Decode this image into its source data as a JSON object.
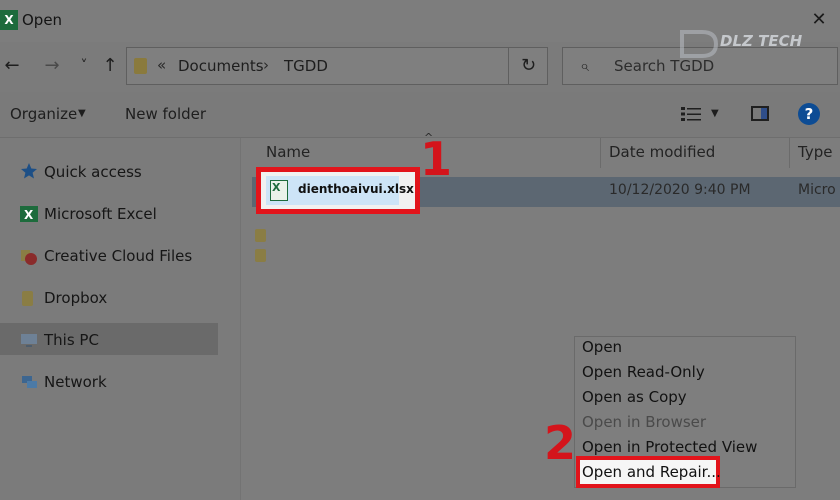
{
  "window": {
    "app_icon_letter": "X",
    "title": "Open",
    "close_glyph": "✕"
  },
  "nav": {
    "back_glyph": "←",
    "forward_glyph": "→",
    "recent_glyph": "˅",
    "up_glyph": "↑",
    "crumb_prefix": "«",
    "breadcrumbs": [
      "Documents",
      "TGDD"
    ],
    "crumb_separator": "›",
    "refresh_glyph": "↻",
    "search_placeholder": "Search TGDD"
  },
  "watermark": {
    "text": "DLZ TECH"
  },
  "toolbar": {
    "organize_label": "Organize",
    "dropdown_glyph": "▼",
    "new_folder_label": "New folder",
    "help_glyph": "?"
  },
  "sidebar": {
    "items": [
      {
        "label": "Quick access",
        "icon": "star-icon"
      },
      {
        "label": "Microsoft Excel",
        "icon": "excel-icon"
      },
      {
        "label": "Creative Cloud Files",
        "icon": "creative-cloud-icon"
      },
      {
        "label": "Dropbox",
        "icon": "dropbox-icon"
      },
      {
        "label": "This PC",
        "icon": "pc-icon",
        "selected": true
      },
      {
        "label": "Network",
        "icon": "network-icon"
      }
    ]
  },
  "file_list": {
    "columns": {
      "name": "Name",
      "date": "Date modified",
      "type": "Type"
    },
    "sort_glyph": "^",
    "rows": [
      {
        "name": "dienthoaivui.xlsx",
        "date": "10/12/2020 9:40 PM",
        "type": "Micro",
        "icon": "excel-file-icon",
        "selected": true
      }
    ]
  },
  "annotations": {
    "step1": "1",
    "step2": "2"
  },
  "open_menu": {
    "items": [
      {
        "label": "Open",
        "enabled": true
      },
      {
        "label": "Open Read-Only",
        "enabled": true
      },
      {
        "label": "Open as Copy",
        "enabled": true
      },
      {
        "label": "Open in Browser",
        "enabled": false
      },
      {
        "label": "Open in Protected View",
        "enabled": true
      },
      {
        "label": "Open and Repair...",
        "enabled": true,
        "highlighted": true
      }
    ]
  },
  "colors": {
    "dim_overlay": "#7b7b7b",
    "highlight_red": "#e2141b",
    "excel_green": "#1d6b3c",
    "help_blue": "#0d4c94"
  }
}
